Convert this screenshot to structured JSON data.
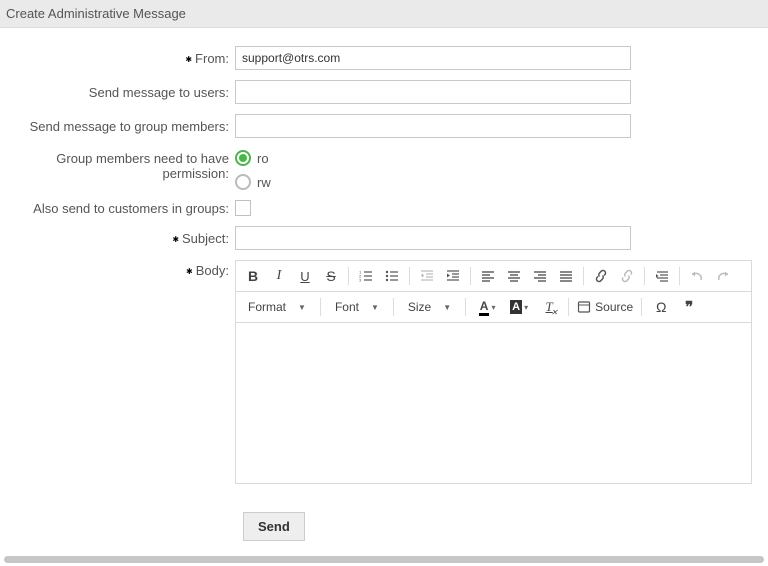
{
  "header": {
    "title": "Create Administrative Message"
  },
  "labels": {
    "from": "From:",
    "users": "Send message to users:",
    "groups": "Send message to group members:",
    "permission": "Group members need to have permission:",
    "customers": "Also send to customers in groups:",
    "subject": "Subject:",
    "body": "Body:"
  },
  "values": {
    "from": "support@otrs.com",
    "users": "",
    "groups": "",
    "subject": "",
    "body": ""
  },
  "permission": {
    "options": {
      "ro": "ro",
      "rw": "rw"
    },
    "selected": "ro"
  },
  "customers_in_groups": false,
  "editor": {
    "format": "Format",
    "font": "Font",
    "size": "Size",
    "source": "Source"
  },
  "actions": {
    "send": "Send"
  }
}
